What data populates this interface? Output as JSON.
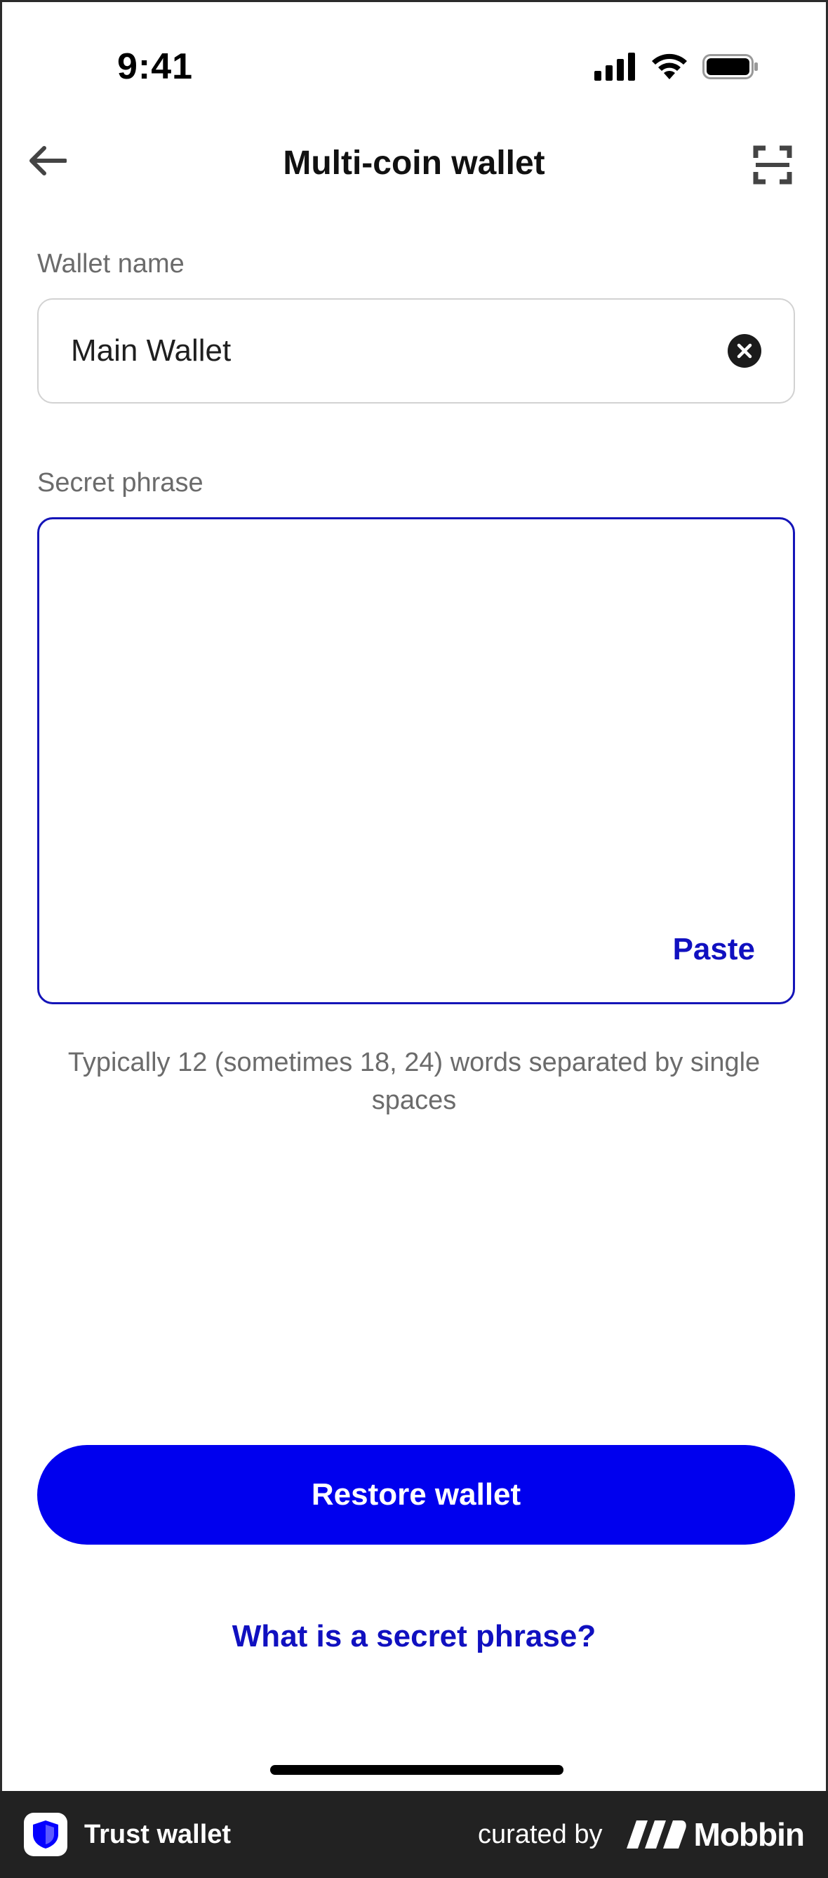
{
  "status_bar": {
    "time": "9:41"
  },
  "nav": {
    "title": "Multi-coin wallet"
  },
  "wallet_name": {
    "label": "Wallet name",
    "value": "Main Wallet"
  },
  "secret_phrase": {
    "label": "Secret phrase",
    "value": "",
    "paste_label": "Paste"
  },
  "helper_text": "Typically 12 (sometimes 18, 24) words separated by single spaces",
  "restore_button": "Restore wallet",
  "secret_link": "What is a secret phrase?",
  "footer": {
    "app_name": "Trust wallet",
    "curated_by": "curated by",
    "brand": "Mobbin"
  },
  "colors": {
    "accent": "#0000ee",
    "link": "#1010c0",
    "footer_bg": "#222222"
  }
}
